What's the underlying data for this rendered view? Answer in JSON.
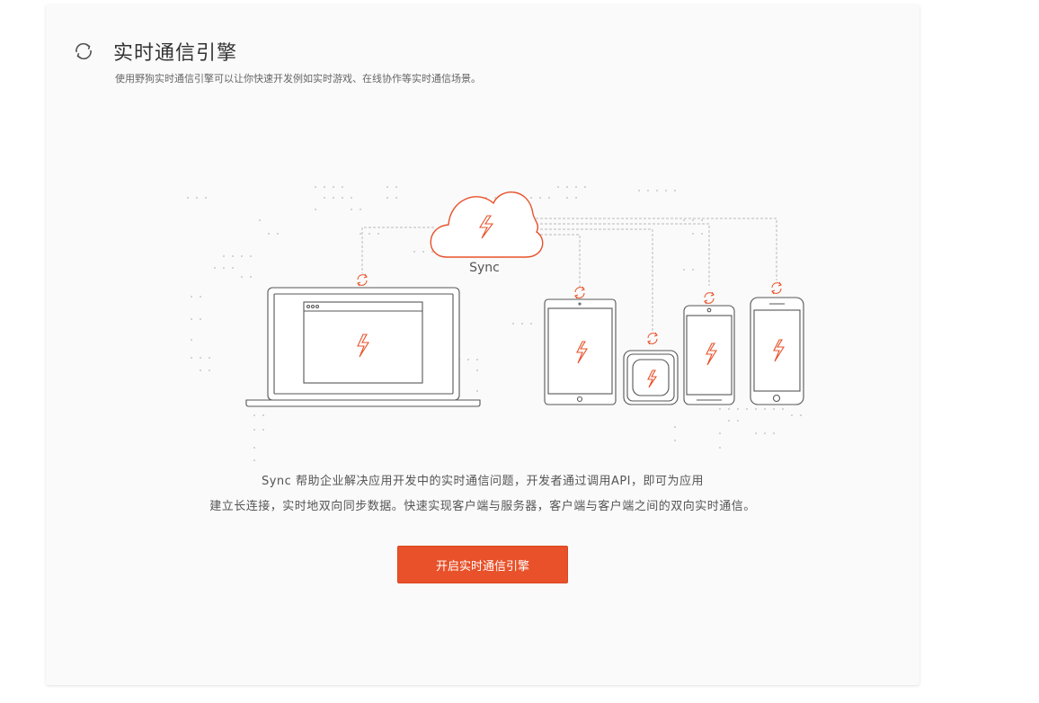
{
  "colors": {
    "accent": "#e8512a",
    "card_bg": "#fafafa",
    "page_bg": "#ffffff",
    "line": "#555555"
  },
  "header": {
    "icon": "sync-icon",
    "title": "实时通信引擎",
    "subtitle": "使用野狗实时通信引擎可以让你快速开发例如实时游戏、在线协作等实时通信场景。"
  },
  "illustration": {
    "cloud_label": "Sync",
    "icons": [
      "cloud-icon",
      "laptop-icon",
      "tablet-icon",
      "smartwatch-icon",
      "android-phone-icon",
      "iphone-icon",
      "lightning-icon",
      "sync-icon"
    ]
  },
  "description": {
    "line1": "Sync 帮助企业解决应用开发中的实时通信问题，开发者通过调用API，即可为应用",
    "line2": "建立长连接，实时地双向同步数据。快速实现客户端与服务器，客户端与客户端之间的双向实时通信。"
  },
  "cta": {
    "label": "开启实时通信引擎"
  }
}
